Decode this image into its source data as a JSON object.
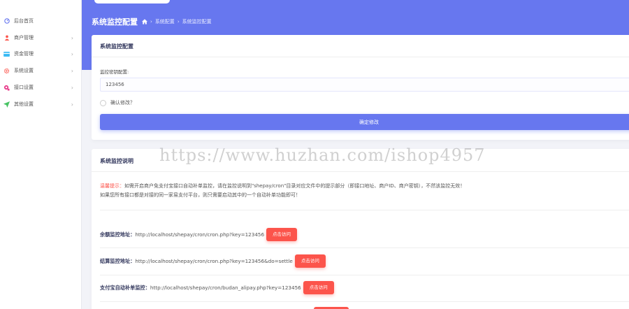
{
  "sidebar": {
    "items": [
      {
        "label": "后台首页",
        "icon": "dashboard-icon",
        "color": "#6777ef",
        "chevron": false
      },
      {
        "label": "商户管理",
        "icon": "user-icon",
        "color": "#fc544b",
        "chevron": true
      },
      {
        "label": "资金管理",
        "icon": "wallet-icon",
        "color": "#3abaf4",
        "chevron": true
      },
      {
        "label": "系统设置",
        "icon": "gear-icon",
        "color": "#fc544b",
        "chevron": true
      },
      {
        "label": "接口设置",
        "icon": "plug-icon",
        "color": "#e83e8c",
        "chevron": true
      },
      {
        "label": "其他设置",
        "icon": "send-icon",
        "color": "#47c363",
        "chevron": true
      }
    ]
  },
  "header": {
    "title": "系统监控配置",
    "breadcrumb": [
      "系统配置",
      "系统监控配置"
    ]
  },
  "config_card": {
    "title": "系统监控配置",
    "field_label": "监控密钥配置:",
    "input_value": "123456",
    "checkbox_label": "确认修改？",
    "submit_label": "确定修改"
  },
  "info_card": {
    "title": "系统监控说明",
    "desc_prefix": "温馨提示：",
    "desc_line1": "如需开启商户免支付宝接口自动补单监控，请在监控说明到\"shepay/cron\"目录对应文件中的提示部分（即接口地址、商户ID、商户密钥），不然该监控无效！",
    "desc_line2": "如果您所有接口都是对接的同一家易支付平台，则只需要启动其中的一个自动补单功能即可！",
    "rows": [
      {
        "label": "余额监控地址：",
        "url": "http://localhost/shepay/cron/cron.php?key=123456",
        "button": "点击访问"
      },
      {
        "label": "结算监控地址：",
        "url": "http://localhost/shepay/cron/cron.php?key=123456&do=settle",
        "button": "点击访问"
      },
      {
        "label": "支付宝自动补单监控：",
        "url": "http://localhost/shepay/cron/budan_alipay.php?key=123456",
        "button": "点击访问"
      }
    ]
  },
  "watermark": "https://www.huzhan.com/ishop4957",
  "colors": {
    "primary": "#6777ef",
    "danger": "#fc544b",
    "background": "#f2f3f8"
  }
}
